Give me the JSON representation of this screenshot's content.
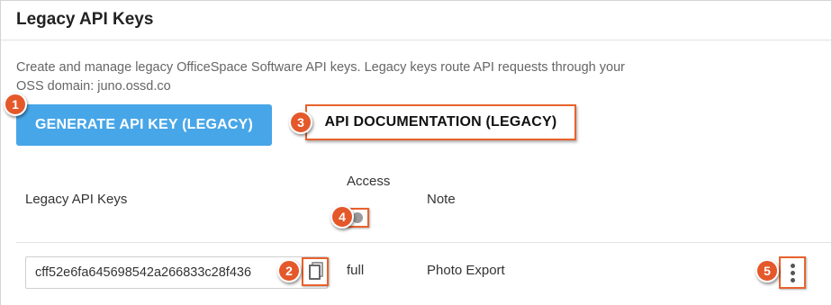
{
  "panel": {
    "title": "Legacy API Keys",
    "description": "Create and manage legacy OfficeSpace Software API keys. Legacy keys route API requests through your OSS domain: juno.ossd.co"
  },
  "actions": {
    "generate_label": "GENERATE API KEY (LEGACY)",
    "docs_label": "API DOCUMENTATION (LEGACY)"
  },
  "table": {
    "headers": {
      "keys": "Legacy API Keys",
      "access": "Access",
      "note": "Note"
    },
    "rows": [
      {
        "key": "cff52e6fa645698542a266833c28f436",
        "access": "full",
        "note": "Photo Export"
      }
    ]
  },
  "icons": {
    "info": "info-icon",
    "copy": "copy-icon",
    "menu": "kebab-menu-icon"
  },
  "markers": [
    "1",
    "2",
    "3",
    "4",
    "5"
  ],
  "colors": {
    "primary_button": "#47a6e8",
    "highlight": "#e8622c",
    "marker": "#e4582a"
  }
}
